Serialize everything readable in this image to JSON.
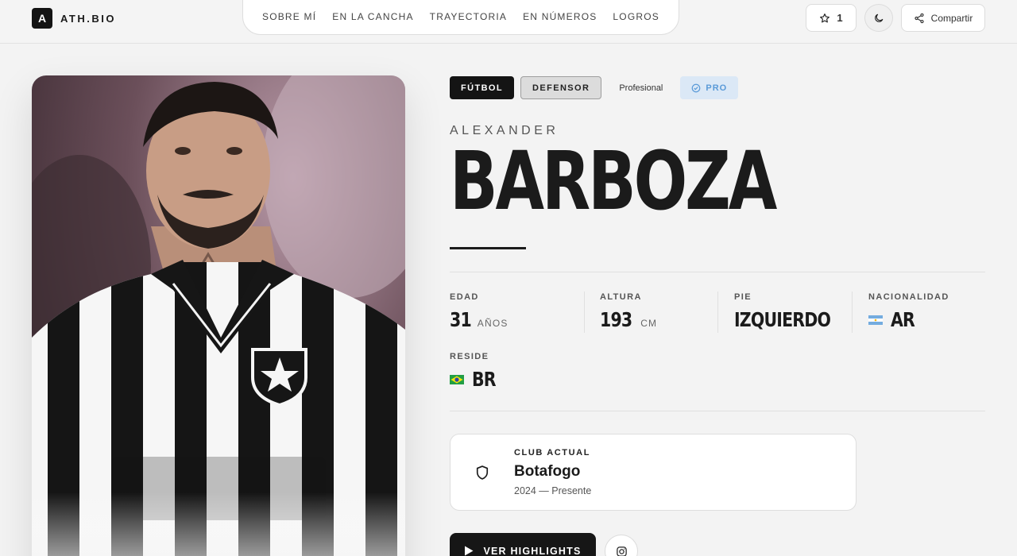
{
  "brand": {
    "mark": "A",
    "name": "ATH.BIO"
  },
  "nav": {
    "items": [
      "SOBRE MÍ",
      "EN LA CANCHA",
      "TRAYECTORIA",
      "EN NÚMEROS",
      "LOGROS"
    ]
  },
  "header_actions": {
    "favorites_count": "1",
    "share_label": "Compartir"
  },
  "tags": {
    "sport": "FÚTBOL",
    "position": "DEFENSOR",
    "level": "Profesional",
    "pro_badge": "PRO"
  },
  "athlete": {
    "first_name": "ALEXANDER",
    "last_name": "BARBOZA"
  },
  "stats": {
    "age": {
      "label": "EDAD",
      "value": "31",
      "unit": "AÑOS"
    },
    "height": {
      "label": "ALTURA",
      "value": "193",
      "unit": "CM"
    },
    "foot": {
      "label": "PIE",
      "value": "IZQUIERDO"
    },
    "nationality": {
      "label": "NACIONALIDAD",
      "value": "AR",
      "flag": "argentina-flag"
    },
    "residence": {
      "label": "RESIDE",
      "value": "BR",
      "flag": "brazil-flag"
    }
  },
  "club": {
    "kicker": "CLUB ACTUAL",
    "name": "Botafogo",
    "period": "2024 — Presente"
  },
  "cta": {
    "label": "VER HIGHLIGHTS"
  },
  "colors": {
    "primary": "#141414",
    "background": "#f3f3f3",
    "pro_badge_bg": "#dbe8f6",
    "pro_badge_text": "#5a9ad8"
  },
  "photo": {
    "subject": "player portrait in black and white striped jersey"
  }
}
